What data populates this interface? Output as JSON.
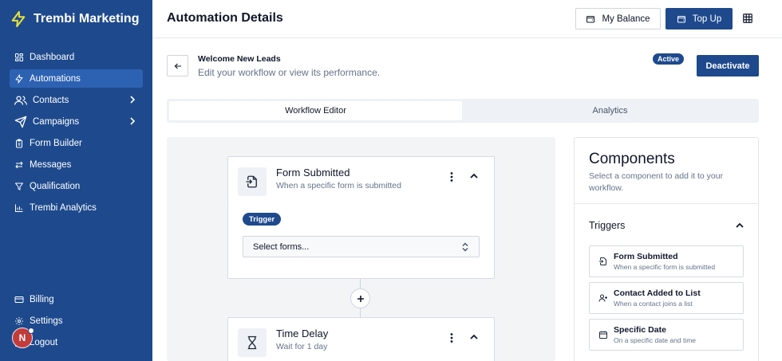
{
  "app": {
    "name": "Trembi Marketing"
  },
  "sidebar": {
    "items": [
      {
        "label": "Dashboard",
        "icon": "dashboard-icon"
      },
      {
        "label": "Automations",
        "icon": "lightning-icon",
        "active": true
      },
      {
        "label": "Contacts",
        "icon": "users-icon",
        "has_submenu": true
      },
      {
        "label": "Campaigns",
        "icon": "send-icon",
        "has_submenu": true
      },
      {
        "label": "Form Builder",
        "icon": "clipboard-icon"
      },
      {
        "label": "Messages",
        "icon": "arrows-icon"
      },
      {
        "label": "Qualification",
        "icon": "filter-icon"
      },
      {
        "label": "Trembi Analytics",
        "icon": "chart-icon"
      }
    ],
    "bottom_items": [
      {
        "label": "Billing",
        "icon": "card-icon"
      },
      {
        "label": "Settings",
        "icon": "gear-icon"
      },
      {
        "label": "Logout",
        "icon": "logout-icon"
      }
    ],
    "avatar_initial": "N"
  },
  "header": {
    "title": "Automation Details",
    "balance_label": "My Balance",
    "topup_label": "Top Up"
  },
  "workflow": {
    "name": "Welcome New Leads",
    "subtitle": "Edit your workflow or view its performance.",
    "status": "Active",
    "deactivate_label": "Deactivate"
  },
  "tabs": [
    {
      "label": "Workflow Editor",
      "active": true
    },
    {
      "label": "Analytics",
      "active": false
    }
  ],
  "nodes": [
    {
      "title": "Form Submitted",
      "subtitle": "When a specific form is submitted",
      "badge": "Trigger",
      "select_placeholder": "Select forms...",
      "icon": "form-enter-icon"
    },
    {
      "title": "Time Delay",
      "subtitle": "Wait for 1 day",
      "icon": "hourglass-icon"
    }
  ],
  "components": {
    "title": "Components",
    "subtitle": "Select a component to add it to your workflow.",
    "sections": [
      {
        "title": "Triggers",
        "items": [
          {
            "name": "Form Submitted",
            "description": "When a specific form is submitted",
            "icon": "form-enter-icon"
          },
          {
            "name": "Contact Added to List",
            "description": "When a contact joins a list",
            "icon": "user-plus-icon"
          },
          {
            "name": "Specific Date",
            "description": "On a specific date and time",
            "icon": "calendar-icon"
          }
        ]
      }
    ]
  },
  "colors": {
    "primary": "#1e4a8d",
    "active_nav": "#2d62b3",
    "accent_logo": "#e6e23a"
  }
}
